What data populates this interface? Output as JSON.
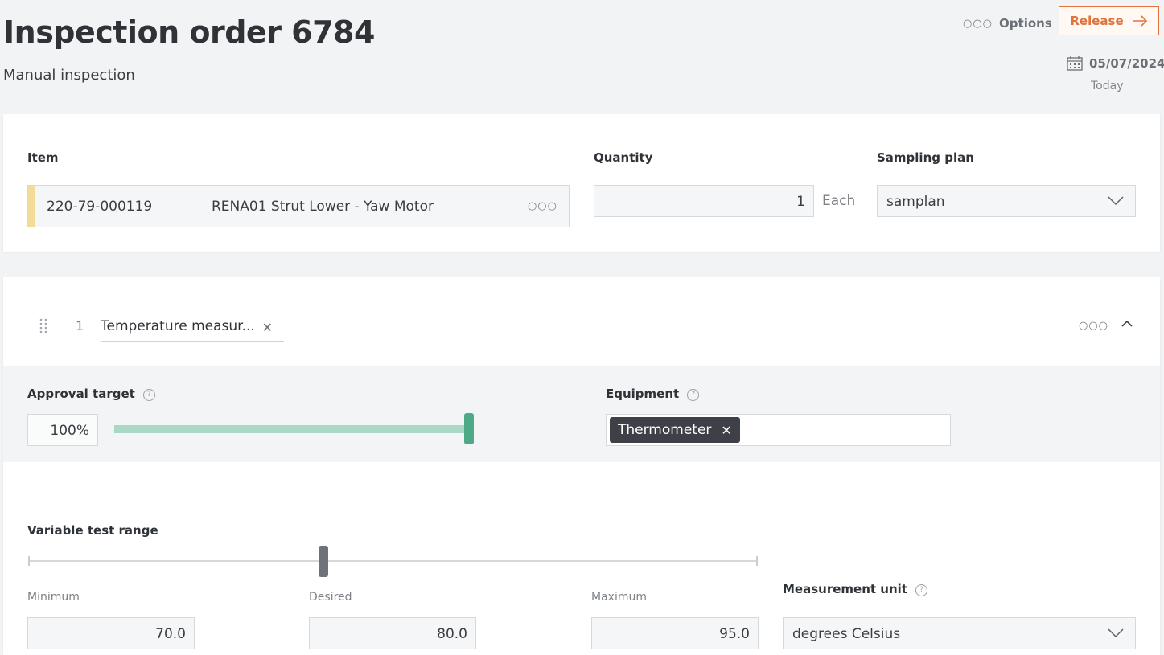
{
  "header": {
    "title": "Inspection order 6784",
    "subtitle": "Manual inspection",
    "options_label": "Options",
    "release_label": "Release",
    "date": "05/07/2024",
    "date_caption": "Today"
  },
  "item_card": {
    "item_label": "Item",
    "item_code": "220-79-000119",
    "item_name": "RENA01 Strut Lower - Yaw Motor",
    "quantity_label": "Quantity",
    "quantity_value": "1",
    "quantity_unit": "Each",
    "sampling_label": "Sampling plan",
    "sampling_value": "samplan"
  },
  "step": {
    "number": "1",
    "name": "Temperature measur...",
    "approval_label": "Approval target",
    "approval_value": "100%",
    "approval_fraction": 1.0,
    "equipment_label": "Equipment",
    "equipment_chip": "Thermometer",
    "range_label": "Variable test range",
    "minimum_label": "Minimum",
    "minimum_value": "70.0",
    "desired_label": "Desired",
    "desired_value": "80.0",
    "maximum_label": "Maximum",
    "maximum_value": "95.0",
    "unit_label": "Measurement unit",
    "unit_value": "degrees Celsius"
  },
  "colors": {
    "accent": "#e0733a",
    "slider_fill": "#a9d9c6",
    "slider_thumb": "#4ea987",
    "item_accent": "#f2dc9a"
  },
  "icons": {
    "options": "ellipsis-icon",
    "release": "arrow-right-icon",
    "date": "calendar-icon",
    "help": "question-circle-icon",
    "remove": "close-icon",
    "collapse": "chevron-up-icon",
    "dropdown": "chevron-down-icon",
    "drag": "drag-handle-icon"
  }
}
